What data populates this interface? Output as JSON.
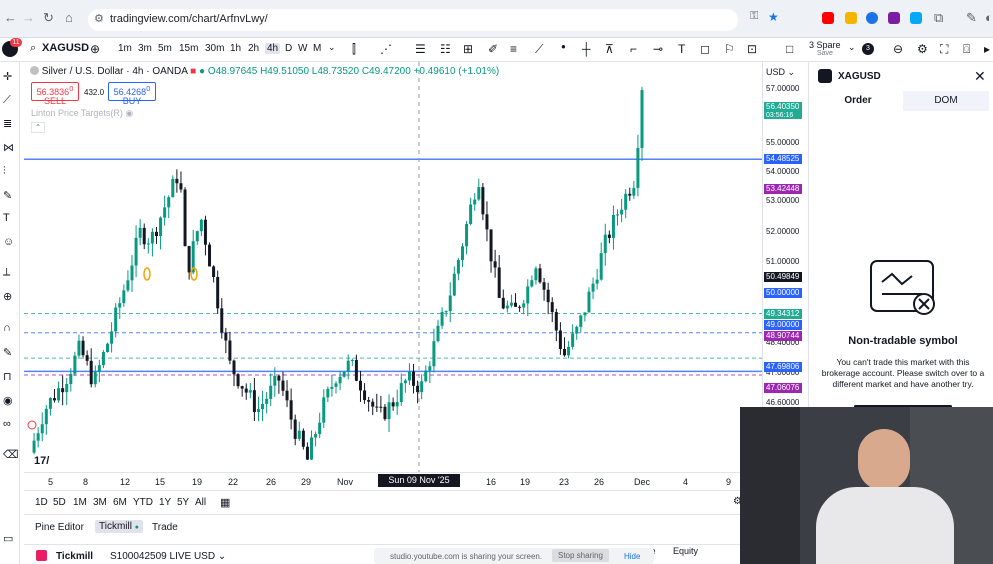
{
  "browser": {
    "url": "tradingview.com/chart/ArfnvLwy/",
    "profile_badge": "11"
  },
  "toolbar": {
    "symbol": "XAGUSD",
    "timeframes": [
      "1m",
      "3m",
      "5m",
      "15m",
      "30m",
      "1h",
      "2h",
      "4h",
      "D",
      "W",
      "M"
    ],
    "active_timeframe": "4h",
    "layout_name": "3 Spare",
    "layout_sub": "Save",
    "alerts_count": "3"
  },
  "legend": {
    "title": "Silver / U.S. Dollar · 4h · OANDA",
    "ohlc": "O48.97645 H49.51050 L48.73520 C49.47200 +0.49610 (+1.01%)",
    "sell_price": "56.3836",
    "sell_sup": "0",
    "sell_label": "SELL",
    "spread": "432.0",
    "buy_price": "56.4268",
    "buy_sup": "0",
    "buy_label": "BUY",
    "indicator": "Linton Price Targets(R)"
  },
  "price_scale": {
    "currency": "USD",
    "ticks": [
      "57.00000",
      "55.00000",
      "54.00000",
      "53.00000",
      "52.00000",
      "51.00000",
      "48.40000",
      "47.00000",
      "46.60000"
    ],
    "labels": [
      {
        "text": "56.40350",
        "sub": "03:56:16",
        "color": "#22ab94"
      },
      {
        "text": "54.48525",
        "color": "#2962ff"
      },
      {
        "text": "53.42448",
        "color": "#9c27b0"
      },
      {
        "text": "50.49849",
        "color": "#131722"
      },
      {
        "text": "50.00000",
        "color": "#2962ff"
      },
      {
        "text": "49.34312",
        "color": "#22ab94"
      },
      {
        "text": "49.00000",
        "color": "#2962ff"
      },
      {
        "text": "48.90744",
        "color": "#9c27b0"
      },
      {
        "text": "47.69806",
        "color": "#2962ff"
      },
      {
        "text": "47.06076",
        "color": "#9c27b0"
      }
    ]
  },
  "time_axis": {
    "labels": [
      "5",
      "8",
      "12",
      "15",
      "19",
      "22",
      "26",
      "29",
      "Nov",
      "16",
      "19",
      "23",
      "26",
      "Dec",
      "4",
      "9"
    ],
    "cursor_label": "Sun 09 Nov '25  21:00"
  },
  "ranges": [
    "1D",
    "5D",
    "1M",
    "3M",
    "6M",
    "YTD",
    "1Y",
    "5Y",
    "All"
  ],
  "bottom_tabs": [
    "Pine Editor",
    "Tickmill",
    "Trade"
  ],
  "active_bottom_tab": "Tickmill",
  "account": {
    "broker": "Tickmill",
    "account_id": "S100042509 LIVE USD",
    "equity_label": "Equity",
    "ce_label": "ce"
  },
  "share_bar": {
    "text": "studio.youtube.com is sharing your screen.",
    "stop": "Stop sharing",
    "hide": "Hide"
  },
  "order_panel": {
    "symbol": "XAGUSD",
    "tabs": [
      "Order",
      "DOM"
    ],
    "title": "Non-tradable symbol",
    "description": "You can't trade this market with this brokerage account. Please switch over to a different market and have another try."
  },
  "colors": {
    "up": "#089981",
    "down": "#131722",
    "hline_blue": "#2962ff",
    "hline_teal": "#22ab94",
    "marker": "#f7a600"
  },
  "chart_data": {
    "type": "candlestick",
    "symbol": "XAGUSD",
    "timeframe": "4h",
    "ylim": [
      46.4,
      57.0
    ],
    "horizontal_levels": [
      {
        "value": 54.48525,
        "color": "#2962ff"
      },
      {
        "value": 50.0,
        "color": "#2962ff",
        "style": "dashed"
      },
      {
        "value": 49.34312,
        "color": "#22ab94",
        "style": "dashed"
      },
      {
        "value": 49.0,
        "color": "#2962ff"
      },
      {
        "value": 48.90744,
        "color": "#9c27b0",
        "style": "dashed"
      },
      {
        "value": 50.49849,
        "color": "#22ab94",
        "style": "dashed"
      }
    ],
    "path": [
      [
        0,
        46.9
      ],
      [
        0.02,
        48.0
      ],
      [
        0.05,
        48.8
      ],
      [
        0.07,
        49.6
      ],
      [
        0.09,
        48.7
      ],
      [
        0.11,
        49.8
      ],
      [
        0.13,
        51.0
      ],
      [
        0.155,
        52.6
      ],
      [
        0.17,
        52.4
      ],
      [
        0.19,
        53.3
      ],
      [
        0.21,
        54.2
      ],
      [
        0.22,
        51.5
      ],
      [
        0.24,
        53.0
      ],
      [
        0.26,
        51.2
      ],
      [
        0.28,
        49.2
      ],
      [
        0.3,
        48.6
      ],
      [
        0.32,
        48.0
      ],
      [
        0.35,
        48.8
      ],
      [
        0.37,
        47.6
      ],
      [
        0.39,
        46.7
      ],
      [
        0.41,
        48.0
      ],
      [
        0.43,
        48.9
      ],
      [
        0.45,
        49.2
      ],
      [
        0.47,
        48.5
      ],
      [
        0.49,
        47.8
      ],
      [
        0.51,
        48.2
      ],
      [
        0.53,
        48.8
      ],
      [
        0.55,
        48.6
      ],
      [
        0.57,
        49.8
      ],
      [
        0.59,
        51.0
      ],
      [
        0.61,
        52.5
      ],
      [
        0.63,
        54.1
      ],
      [
        0.64,
        52.8
      ],
      [
        0.66,
        50.8
      ],
      [
        0.68,
        50.5
      ],
      [
        0.7,
        51.2
      ],
      [
        0.71,
        51.9
      ],
      [
        0.73,
        50.7
      ],
      [
        0.75,
        49.4
      ],
      [
        0.77,
        50.1
      ],
      [
        0.79,
        51.2
      ],
      [
        0.81,
        52.4
      ],
      [
        0.83,
        53.3
      ],
      [
        0.85,
        54.0
      ],
      [
        0.86,
        56.4
      ]
    ]
  }
}
